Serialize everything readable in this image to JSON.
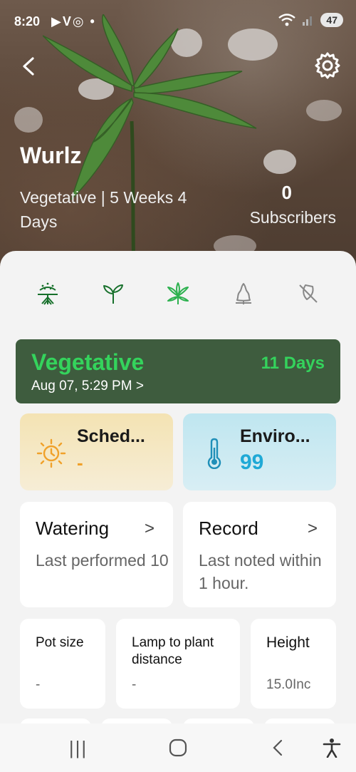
{
  "status_bar": {
    "time": "8:20",
    "left_icons": "▶V◎ •",
    "battery": "47"
  },
  "header": {
    "plant_name": "Wurlz",
    "stage_summary": "Vegetative | 5 Weeks 4 Days",
    "subscribers_count": "0",
    "subscribers_label": "Subscribers"
  },
  "stages": {
    "icons": [
      "germination-icon",
      "seedling-icon",
      "vegetative-icon",
      "flowering-icon",
      "harvest-icon"
    ],
    "colors": {
      "done": "#17702b",
      "current": "#2db14f",
      "pending": "#dedede"
    }
  },
  "stage_card": {
    "title": "Vegetative",
    "date": "Aug 07, 5:29 PM >",
    "days": "11 Days"
  },
  "tiles": {
    "schedule": {
      "title": "Sched...",
      "value": "-"
    },
    "environment": {
      "title": "Enviro...",
      "value": "99"
    },
    "watering": {
      "title": "Watering",
      "chevron": ">",
      "desc": "Last performed 10"
    },
    "record": {
      "title": "Record",
      "chevron": ">",
      "desc": "Last noted within 1 hour."
    },
    "pot_size": {
      "title": "Pot size",
      "value": "-"
    },
    "lamp": {
      "title": "Lamp to plant distance",
      "value": "-"
    },
    "height": {
      "title": "Height",
      "value": "15.0Inc"
    }
  },
  "nav": {
    "recents": "|||",
    "home": "○",
    "back": "<"
  }
}
